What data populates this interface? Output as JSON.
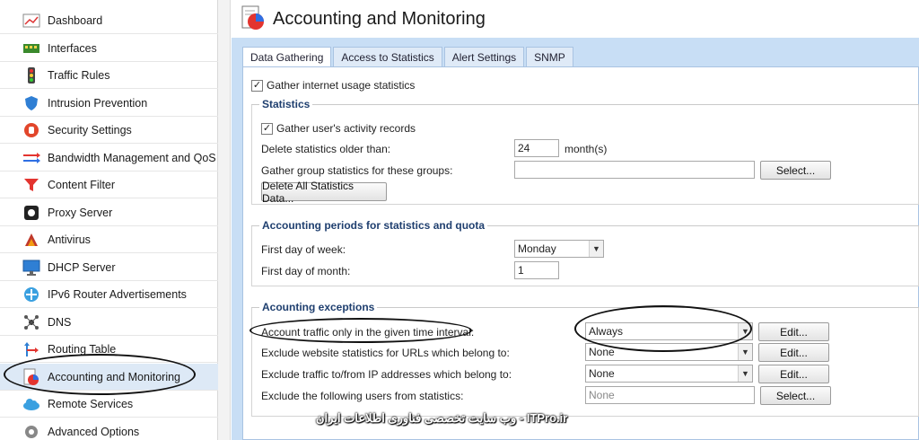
{
  "sidebar": {
    "items": [
      {
        "label": "Dashboard",
        "icon": "dashboard-icon"
      },
      {
        "label": "Interfaces",
        "icon": "network-card-icon"
      },
      {
        "label": "Traffic Rules",
        "icon": "traffic-light-icon"
      },
      {
        "label": "Intrusion Prevention",
        "icon": "shield-icon"
      },
      {
        "label": "Security Settings",
        "icon": "stop-hand-icon"
      },
      {
        "label": "Bandwidth Management and QoS",
        "icon": "bandwidth-arrows-icon"
      },
      {
        "label": "Content Filter",
        "icon": "funnel-icon"
      },
      {
        "label": "Proxy Server",
        "icon": "proxy-icon"
      },
      {
        "label": "Antivirus",
        "icon": "antivirus-icon"
      },
      {
        "label": "DHCP Server",
        "icon": "monitor-icon"
      },
      {
        "label": "IPv6 Router Advertisements",
        "icon": "router-icon"
      },
      {
        "label": "DNS",
        "icon": "dns-icon"
      },
      {
        "label": "Routing Table",
        "icon": "routing-icon"
      },
      {
        "label": "Accounting and Monitoring",
        "icon": "accounting-chart-icon",
        "active": true
      },
      {
        "label": "Remote Services",
        "icon": "cloud-icon"
      },
      {
        "label": "Advanced Options",
        "icon": "gear-icon"
      }
    ]
  },
  "header": {
    "title": "Accounting and Monitoring",
    "icon": "accounting-chart-icon"
  },
  "tabs": [
    {
      "label": "Data Gathering",
      "active": true
    },
    {
      "label": "Access to Statistics"
    },
    {
      "label": "Alert Settings"
    },
    {
      "label": "SNMP"
    }
  ],
  "gather": {
    "label": "Gather internet usage statistics",
    "checked": true
  },
  "statistics": {
    "title": "Statistics",
    "activity_label": "Gather user's activity records",
    "activity_checked": true,
    "delete_label": "Delete statistics older than:",
    "delete_value": "24",
    "delete_unit": "month(s)",
    "groups_label": "Gather group statistics for these groups:",
    "groups_value": "",
    "select_button": "Select...",
    "delete_all_button": "Delete All Statistics Data..."
  },
  "periods": {
    "title": "Accounting periods for statistics and quota",
    "week_label": "First day of week:",
    "week_value": "Monday",
    "month_label": "First day of month:",
    "month_value": "1"
  },
  "exceptions": {
    "title": "Acounting exceptions",
    "rows": [
      {
        "label": "Account traffic only in the given time interval:",
        "value": "Always",
        "button": "Edit..."
      },
      {
        "label": "Exclude website statistics for URLs which belong to:",
        "value": "None",
        "button": "Edit..."
      },
      {
        "label": "Exclude traffic to/from IP addresses which belong to:",
        "value": "None",
        "button": "Edit..."
      },
      {
        "label": "Exclude the following users from statistics:",
        "placeholder": "None",
        "button": "Select..."
      }
    ]
  },
  "watermark": "وب سایت تخصصی فناوری اطلاعات ایران - ITPro.ir"
}
